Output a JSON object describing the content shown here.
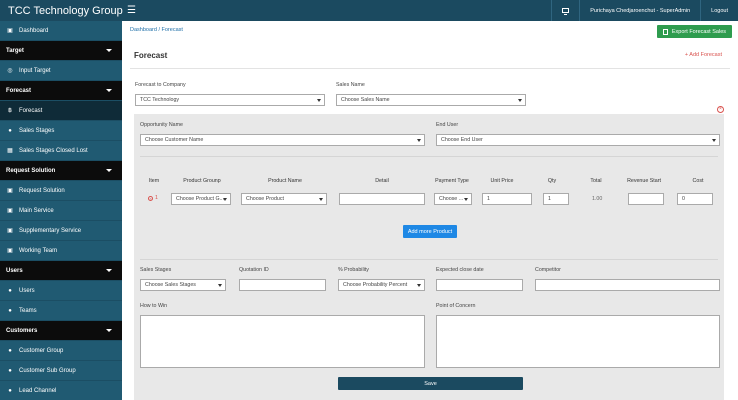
{
  "app": {
    "title": "TCC Technology Group",
    "user": "Purichaya Chedjaroenchut - SuperAdmin",
    "logout": "Logout"
  },
  "sidebar": {
    "items": [
      {
        "label": "Dashboard",
        "type": "item",
        "icon": "dashboard-icon"
      },
      {
        "label": "Target",
        "type": "header"
      },
      {
        "label": "Input Target",
        "type": "item",
        "icon": "target-icon"
      },
      {
        "label": "Forecast",
        "type": "header"
      },
      {
        "label": "Forecast",
        "type": "item",
        "icon": "baht-icon",
        "active": true
      },
      {
        "label": "Sales Stages",
        "type": "item",
        "icon": "stage-icon"
      },
      {
        "label": "Sales Stages Closed Lost",
        "type": "item",
        "icon": "closed-lost-icon"
      },
      {
        "label": "Request Solution",
        "type": "header"
      },
      {
        "label": "Request Solution",
        "type": "item",
        "icon": "share-icon"
      },
      {
        "label": "Main Service",
        "type": "item",
        "icon": "share-icon"
      },
      {
        "label": "Supplementary Service",
        "type": "item",
        "icon": "share-icon"
      },
      {
        "label": "Working Team",
        "type": "item",
        "icon": "share-icon"
      },
      {
        "label": "Users",
        "type": "header"
      },
      {
        "label": "Users",
        "type": "item",
        "icon": "user-icon"
      },
      {
        "label": "Teams",
        "type": "item",
        "icon": "teams-icon"
      },
      {
        "label": "Customers",
        "type": "header"
      },
      {
        "label": "Customer Group",
        "type": "item",
        "icon": "customer-group-icon"
      },
      {
        "label": "Customer Sub Group",
        "type": "item",
        "icon": "customer-group-icon"
      },
      {
        "label": "Lead Channel",
        "type": "item",
        "icon": "lead-icon"
      }
    ]
  },
  "breadcrumb": {
    "home": "Dashboard",
    "sep": "/",
    "current": "Forecast"
  },
  "export_button": "Export Forecast Sales",
  "page_title": "Forecast",
  "add_forecast": "+ Add Forecast",
  "form": {
    "company_label": "Forecast to Company",
    "company_value": "TCC Technology",
    "sales_name_label": "Sales Name",
    "sales_name_value": "Choose Sales Name",
    "opportunity_label": "Opportunity Name",
    "opportunity_value": "Choose Customer Name",
    "end_user_label": "End User",
    "end_user_value": "Choose End User"
  },
  "products": {
    "headers": {
      "item": "Item",
      "group": "Product Grounp",
      "name": "Product Name",
      "detail": "Detail",
      "payment": "Payment Type",
      "unit_price": "Unit Price",
      "qty": "Qty",
      "total": "Total",
      "revenue": "Revenue Start",
      "cost": "Cost"
    },
    "row": {
      "num": "1",
      "group": "Choose Product G...",
      "name": "Choose Product",
      "detail": "",
      "payment": "Choose ...",
      "unit_price": "1",
      "qty": "1",
      "total": "1.00",
      "revenue": "",
      "cost": "0"
    },
    "add_button": "Add more Product"
  },
  "details": {
    "sales_stages_label": "Sales Stages",
    "sales_stages_value": "Choose Sales Stages",
    "quotation_label": "Quotation ID",
    "probability_label": "% Probability",
    "probability_value": "Choose Probability Percent",
    "close_date_label": "Expected close date",
    "competitor_label": "Competitor",
    "how_to_win_label": "How to Win",
    "concern_label": "Point of Concern"
  },
  "save_button": "Save"
}
